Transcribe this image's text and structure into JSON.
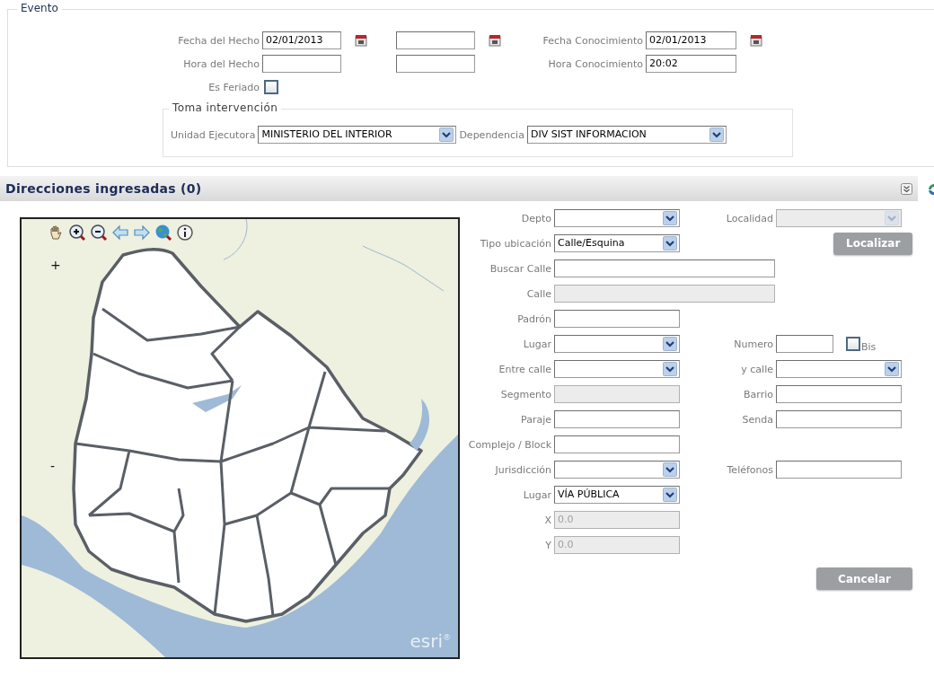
{
  "evento": {
    "legend": "Evento",
    "rows": [
      {
        "cells": [
          {
            "label": "Fecha del Hecho",
            "kind": "date",
            "value": "02/01/2013"
          },
          {
            "kind": "date"
          },
          {
            "label": "Fecha Conocimiento",
            "kind": "date",
            "value": "02/01/2013"
          }
        ]
      },
      {
        "cells": [
          {
            "label": "Hora del Hecho",
            "kind": "text"
          },
          {
            "kind": "text"
          },
          {
            "label": "Hora Conocimiento",
            "kind": "text",
            "value": "20:02"
          }
        ]
      },
      {
        "cells": [
          {
            "label": "Es Feriado",
            "kind": "checkbox",
            "checked": false
          }
        ]
      }
    ],
    "toma_intervencion": {
      "legend": "Toma intervención",
      "cells": [
        {
          "label": "Unidad Ejecutora",
          "kind": "select",
          "value": "MINISTERIO DEL INTERIOR"
        },
        {
          "label": "Dependencia",
          "kind": "select",
          "value": "DIV SIST INFORMACION"
        }
      ]
    }
  },
  "direcciones": {
    "title": "Direcciones ingresadas (0)",
    "map": {
      "zoom_in_label": "+",
      "zoom_out_label": "-",
      "logo": "esri$^{®}$"
    },
    "rows": [
      {
        "cells": [
          {
            "label": "Depto",
            "kind": "select",
            "disabled": false
          },
          {
            "label": "Localidad",
            "kind": "select",
            "disabled": true
          }
        ]
      },
      {
        "cells": [
          {
            "label": "Tipo ubicación",
            "kind": "select",
            "value": "Calle/Esquina",
            "disabled": false
          },
          "",
          {
            "label": "Localizar",
            "kind": "button",
            "disabled": false
          }
        ]
      },
      {
        "cells": [
          {
            "label": "Buscar Calle",
            "kind": "search_text",
            "disabled": false
          }
        ]
      },
      {
        "cells": [
          {
            "label": "Calle",
            "kind": "wide_text",
            "disabled": true
          }
        ]
      },
      {
        "cells": [
          {
            "label": "Padrón",
            "kind": "text",
            "disabled": false
          }
        ]
      },
      {
        "cells": [
          {
            "label": "Lugar",
            "kind": "select",
            "disabled": false
          },
          {
            "label": "Numero",
            "kind": "short_text",
            "disabled": false
          },
          {
            "label": "Bis",
            "kind": "checkbox",
            "checked": false,
            "disabled": false
          }
        ]
      },
      {
        "cells": [
          {
            "label": "Entre calle",
            "kind": "select",
            "disabled": false
          },
          {
            "label": "y calle",
            "kind": "select",
            "disabled": false
          }
        ]
      },
      {
        "cells": [
          {
            "label": "Segmento",
            "kind": "text",
            "disabled": true
          },
          {
            "label": "Barrio",
            "kind": "text",
            "disabled": false
          }
        ]
      },
      {
        "cells": [
          {
            "label": "Paraje",
            "kind": "text",
            "disabled": false
          },
          {
            "label": "Senda",
            "kind": "text",
            "disabled": false
          }
        ]
      },
      {
        "cells": [
          {
            "label": "Complejo / Block",
            "kind": "text",
            "disabled": false
          }
        ]
      },
      {
        "cells": [
          {
            "label": "Jurisdicción",
            "kind": "select",
            "disabled": false
          },
          {
            "label": "Teléfonos",
            "kind": "text",
            "disabled": false
          }
        ]
      },
      {
        "cells": [
          {
            "label": "Lugar",
            "kind": "select",
            "value": "VÍA PÚBLICA",
            "disabled": false
          }
        ]
      },
      {
        "cells": [
          {
            "label": "X",
            "kind": "text",
            "value": "0.0",
            "disabled": true
          }
        ]
      },
      {
        "cells": [
          {
            "label": "Y",
            "kind": "text",
            "value": "0.0",
            "disabled": true
          }
        ]
      }
    ],
    "actions": [
      {
        "label": "Cancelar"
      }
    ]
  }
}
